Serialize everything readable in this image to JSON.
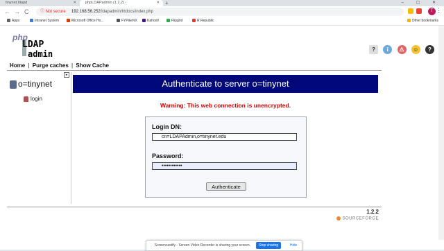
{
  "tabs": [
    {
      "label": "tinynet.ldapd"
    },
    {
      "label": "phpLDAPadmin (1.2.2) - "
    }
  ],
  "new_tab_label": "+",
  "window_controls": "–  ▢  ✕",
  "nav": {
    "back": "←",
    "forward": "→",
    "reload": "C"
  },
  "omnibox": {
    "security": "ⓘ Not secure",
    "url_host": "192.168.56.252",
    "url_path": "/ldapadmin/htdocs/index.php"
  },
  "profile_initial": "T",
  "bookmarks": [
    {
      "label": "Apps",
      "color": "#5f6368"
    },
    {
      "label": "Intranet System",
      "color": "#3c78d8"
    },
    {
      "label": "Microsoft Office Ho...",
      "color": "#d83b01"
    },
    {
      "label": "FYP&eNX",
      "color": "#555555"
    },
    {
      "label": "Kahoot!",
      "color": "#46178f"
    },
    {
      "label": "Flipgrid",
      "color": "#33a853"
    },
    {
      "label": "R.Republic",
      "color": "#e53935"
    }
  ],
  "bookmarks_other": "Other bookmarks",
  "logo": {
    "top": "php",
    "mid": "LDAP",
    "bottom": "admin"
  },
  "menu": {
    "home": "Home",
    "purge": "Purge caches",
    "show_cache": "Show Cache",
    "sep": "|"
  },
  "sidebar": {
    "server": "o=tinynet",
    "login": "login"
  },
  "title": "Authenticate to server o=tinynet",
  "warning": "Warning: This web connection is unencrypted.",
  "form": {
    "login_dn_label": "Login DN:",
    "login_dn_value": "cn=LDAPAdmin,o=tinynet.edu",
    "password_label": "Password:",
    "password_value": "••••••••••••",
    "submit_label": "Authenticate"
  },
  "footer": {
    "version": "1.2.2",
    "sourceforge": "SOURCEFORGE"
  },
  "share_bar": {
    "grip": "⋮⋮",
    "text": "Screencastify - Screen Video Recorder is sharing your screen.",
    "stop": "Stop sharing",
    "hide": "Hide"
  },
  "icons": {
    "help": "?",
    "debug": "i",
    "bug": "⚠",
    "smile": "☺",
    "question": "?"
  },
  "colors": {
    "title_bg": "#00087a",
    "warning": "#d20000",
    "accent": "#1a73e8"
  }
}
